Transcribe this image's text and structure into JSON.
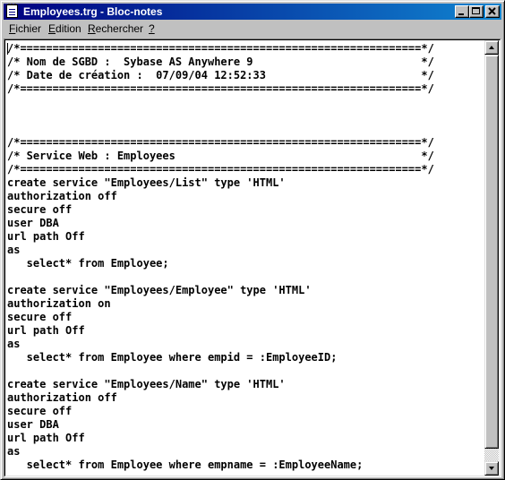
{
  "window": {
    "title": "Employees.trg - Bloc-notes",
    "colors": {
      "titlebar_active": "#000080",
      "titlebar_gradient_end": "#1084d0",
      "face": "#c0c0c0",
      "editor_background": "#ffffff"
    }
  },
  "menu": {
    "items": [
      {
        "mnemonic": "F",
        "rest": "ichier"
      },
      {
        "mnemonic": "E",
        "rest": "dition"
      },
      {
        "mnemonic": "R",
        "rest": "echercher"
      },
      {
        "mnemonic": "?",
        "rest": ""
      }
    ]
  },
  "editor": {
    "lines": [
      "/*==============================================================*/",
      "/* Nom de SGBD :  Sybase AS Anywhere 9                          */",
      "/* Date de création :  07/09/04 12:52:33                        */",
      "/*==============================================================*/",
      "",
      "",
      "",
      "/*==============================================================*/",
      "/* Service Web : Employees                                      */",
      "/*==============================================================*/",
      "create service \"Employees/List\" type 'HTML'",
      "authorization off",
      "secure off",
      "user DBA",
      "url path Off",
      "as",
      "   select* from Employee;",
      "",
      "create service \"Employees/Employee\" type 'HTML'",
      "authorization on",
      "secure off",
      "url path Off",
      "as",
      "   select* from Employee where empid = :EmployeeID;",
      "",
      "create service \"Employees/Name\" type 'HTML'",
      "authorization off",
      "secure off",
      "user DBA",
      "url path Off",
      "as",
      "   select* from Employee where empname = :EmployeeName;"
    ]
  }
}
